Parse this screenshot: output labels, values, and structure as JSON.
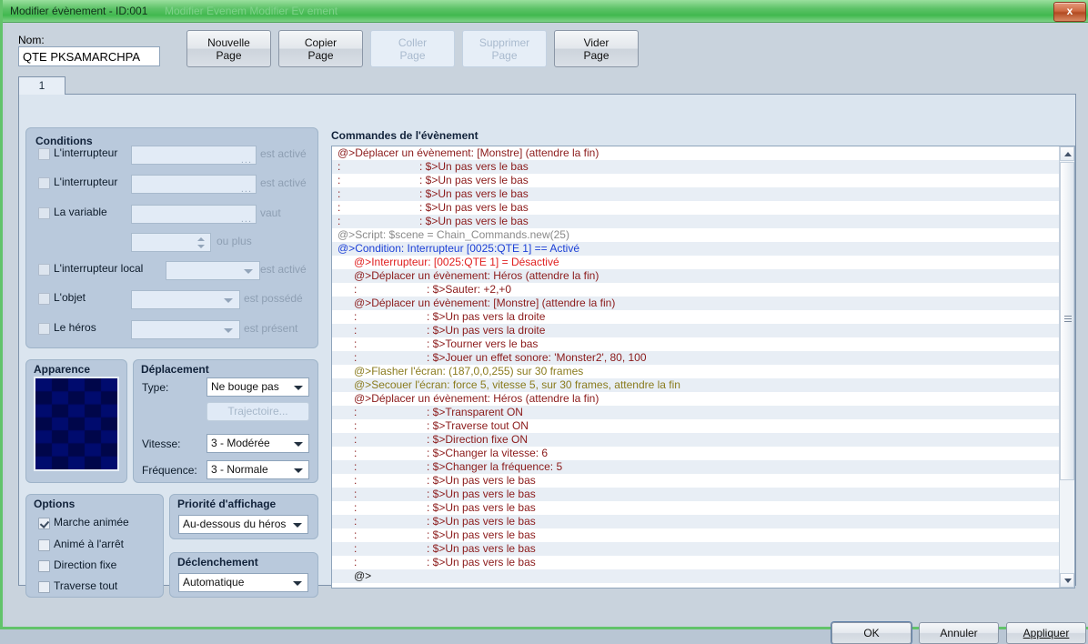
{
  "window": {
    "title": "Modifier évènement - ID:001",
    "title_ghost": "Modifier  Evenem  Modifier  Ev   ement",
    "close_label": "x",
    "accent_title_bg": "#4fbe5b",
    "close_color": "#c05a30"
  },
  "toolbar": {
    "name_label": "Nom:",
    "name_value": "QTE PKSAMARCHPA",
    "buttons": [
      {
        "line1": "Nouvelle",
        "line2": "Page",
        "disabled": false
      },
      {
        "line1": "Copier",
        "line2": "Page",
        "disabled": false
      },
      {
        "line1": "Coller",
        "line2": "Page",
        "disabled": true
      },
      {
        "line1": "Supprimer",
        "line2": "Page",
        "disabled": true
      },
      {
        "line1": "Vider",
        "line2": "Page",
        "disabled": false
      }
    ]
  },
  "tabs": {
    "items": [
      {
        "label": "1",
        "selected": true
      }
    ]
  },
  "conditions": {
    "title": "Conditions",
    "rows": [
      {
        "label": "L'interrupteur",
        "checked": false,
        "field": "",
        "field_kind": "text",
        "suffix": "est activé"
      },
      {
        "label": "L'interrupteur",
        "checked": false,
        "field": "",
        "field_kind": "text",
        "suffix": "est activé"
      },
      {
        "label": "La variable",
        "checked": false,
        "field": "",
        "field_kind": "text",
        "suffix": "vaut"
      },
      {
        "label": "",
        "checked": null,
        "field": "",
        "field_kind": "spin",
        "suffix": "ou plus"
      },
      {
        "label": "L'interrupteur local",
        "checked": false,
        "field": "",
        "field_kind": "combo",
        "suffix": "est activé"
      },
      {
        "label": "L'objet",
        "checked": false,
        "field": "",
        "field_kind": "combo",
        "suffix": "est possédé"
      },
      {
        "label": "Le héros",
        "checked": false,
        "field": "",
        "field_kind": "combo",
        "suffix": "est présent"
      }
    ]
  },
  "apparence": {
    "title": "Apparence",
    "colors": [
      "#000b6e",
      "#00064a"
    ]
  },
  "deplacement": {
    "title": "Déplacement",
    "type_label": "Type:",
    "type_value": "Ne bouge pas",
    "trajectoire_label": "Trajectoire...",
    "vitesse_label": "Vitesse:",
    "vitesse_value": "3 - Modérée",
    "frequence_label": "Fréquence:",
    "frequence_value": "3 - Normale"
  },
  "options": {
    "title": "Options",
    "items": [
      {
        "label": "Marche animée",
        "checked": true
      },
      {
        "label": "Animé à l'arrêt",
        "checked": false
      },
      {
        "label": "Direction fixe",
        "checked": false
      },
      {
        "label": "Traverse tout",
        "checked": false
      }
    ]
  },
  "priorite": {
    "title": "Priorité d'affichage",
    "value": "Au-dessous du héros"
  },
  "declenchement": {
    "title": "Déclenchement",
    "value": "Automatique"
  },
  "commands": {
    "title": "Commandes de l'évènement",
    "colors": {
      "move": "#8b1a1a",
      "script": "#8a8a8a",
      "condition": "#1b3fd6",
      "switch": "#e02020",
      "screen": "#8a7b1e",
      "plain": "#1a1a1a"
    },
    "rows": [
      {
        "indent": 0,
        "prefix": "@>",
        "text": "Déplacer un évènement: [Monstre] (attendre la fin)",
        "color": "move"
      },
      {
        "indent": 0,
        "prefix": ":",
        "text": "                          : $>Un pas vers le bas",
        "color": "move"
      },
      {
        "indent": 0,
        "prefix": ":",
        "text": "                          : $>Un pas vers le bas",
        "color": "move"
      },
      {
        "indent": 0,
        "prefix": ":",
        "text": "                          : $>Un pas vers le bas",
        "color": "move"
      },
      {
        "indent": 0,
        "prefix": ":",
        "text": "                          : $>Un pas vers le bas",
        "color": "move"
      },
      {
        "indent": 0,
        "prefix": ":",
        "text": "                          : $>Un pas vers le bas",
        "color": "move"
      },
      {
        "indent": 0,
        "prefix": "@>",
        "text": "Script: $scene = Chain_Commands.new(25)",
        "color": "script"
      },
      {
        "indent": 0,
        "prefix": "@>",
        "text": "Condition: Interrupteur [0025:QTE 1] == Activé",
        "color": "condition"
      },
      {
        "indent": 1,
        "prefix": "@>",
        "text": "Interrupteur: [0025:QTE 1] = Désactivé",
        "color": "switch"
      },
      {
        "indent": 1,
        "prefix": "@>",
        "text": "Déplacer un évènement: Héros (attendre la fin)",
        "color": "move"
      },
      {
        "indent": 1,
        "prefix": ":",
        "text": "                       : $>Sauter: +2,+0",
        "color": "move"
      },
      {
        "indent": 1,
        "prefix": "@>",
        "text": "Déplacer un évènement: [Monstre] (attendre la fin)",
        "color": "move"
      },
      {
        "indent": 1,
        "prefix": ":",
        "text": "                       : $>Un pas vers la droite",
        "color": "move"
      },
      {
        "indent": 1,
        "prefix": ":",
        "text": "                       : $>Un pas vers la droite",
        "color": "move"
      },
      {
        "indent": 1,
        "prefix": ":",
        "text": "                       : $>Tourner vers le bas",
        "color": "move"
      },
      {
        "indent": 1,
        "prefix": ":",
        "text": "                       : $>Jouer un effet sonore: 'Monster2', 80, 100",
        "color": "move"
      },
      {
        "indent": 1,
        "prefix": "@>",
        "text": "Flasher l'écran: (187,0,0,255) sur 30 frames",
        "color": "screen"
      },
      {
        "indent": 1,
        "prefix": "@>",
        "text": "Secouer l'écran: force 5, vitesse 5, sur 30 frames, attendre la fin",
        "color": "screen"
      },
      {
        "indent": 1,
        "prefix": "@>",
        "text": "Déplacer un évènement: Héros (attendre la fin)",
        "color": "move"
      },
      {
        "indent": 1,
        "prefix": ":",
        "text": "                       : $>Transparent ON",
        "color": "move"
      },
      {
        "indent": 1,
        "prefix": ":",
        "text": "                       : $>Traverse tout ON",
        "color": "move"
      },
      {
        "indent": 1,
        "prefix": ":",
        "text": "                       : $>Direction fixe ON",
        "color": "move"
      },
      {
        "indent": 1,
        "prefix": ":",
        "text": "                       : $>Changer la vitesse: 6",
        "color": "move"
      },
      {
        "indent": 1,
        "prefix": ":",
        "text": "                       : $>Changer la fréquence: 5",
        "color": "move"
      },
      {
        "indent": 1,
        "prefix": ":",
        "text": "                       : $>Un pas vers le bas",
        "color": "move"
      },
      {
        "indent": 1,
        "prefix": ":",
        "text": "                       : $>Un pas vers le bas",
        "color": "move"
      },
      {
        "indent": 1,
        "prefix": ":",
        "text": "                       : $>Un pas vers le bas",
        "color": "move"
      },
      {
        "indent": 1,
        "prefix": ":",
        "text": "                       : $>Un pas vers le bas",
        "color": "move"
      },
      {
        "indent": 1,
        "prefix": ":",
        "text": "                       : $>Un pas vers le bas",
        "color": "move"
      },
      {
        "indent": 1,
        "prefix": ":",
        "text": "                       : $>Un pas vers le bas",
        "color": "move"
      },
      {
        "indent": 1,
        "prefix": ":",
        "text": "                       : $>Un pas vers le bas",
        "color": "move"
      },
      {
        "indent": 1,
        "prefix": "@>",
        "text": "",
        "color": "plain"
      }
    ]
  },
  "footer": {
    "ok": "OK",
    "cancel": "Annuler",
    "apply": "Appliquer",
    "apply_disabled": true
  }
}
